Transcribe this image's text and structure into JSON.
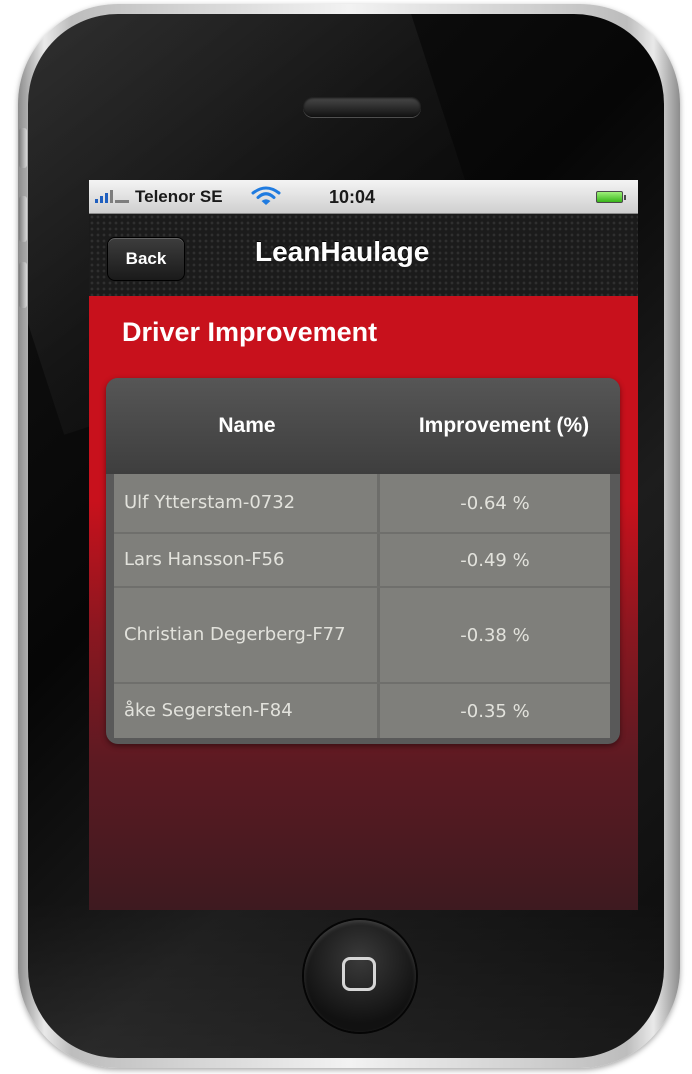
{
  "status_bar": {
    "carrier": "Telenor SE",
    "time": "10:04",
    "signal_icon": "signal-bars-icon",
    "wifi_icon": "wifi-icon",
    "battery_icon": "battery-icon"
  },
  "nav_bar": {
    "back_label": "Back",
    "title": "LeanHaulage"
  },
  "page": {
    "section_title": "Driver Improvement"
  },
  "table": {
    "columns": [
      "Name",
      "Improvement (%)"
    ],
    "rows": [
      {
        "name": "Ulf Ytterstam-0732",
        "value": "-0.64 %"
      },
      {
        "name": "Lars Hansson-F56",
        "value": "-0.49 %"
      },
      {
        "name": "Christian Degerberg-F77",
        "value": "-0.38 %"
      },
      {
        "name": "åke Segersten-F84",
        "value": "-0.35 %"
      }
    ]
  },
  "colors": {
    "accent_red": "#c8111c",
    "nav_dark": "#1b1b1b",
    "table_header": "#4a4a4a",
    "table_row": "#7f7f7b"
  }
}
